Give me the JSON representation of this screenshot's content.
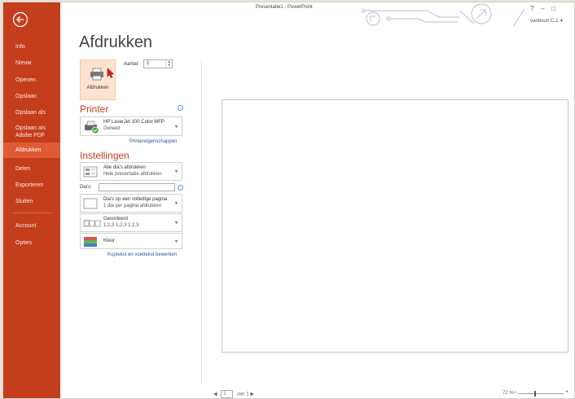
{
  "window": {
    "title": "Presentatie1 - PowerPoint",
    "help": "?",
    "minimize": "–",
    "maximize": "□",
    "user": "vanbuuri C.J. ▾"
  },
  "sidebar": {
    "items": [
      {
        "label": "Info"
      },
      {
        "label": "Nieuw"
      },
      {
        "label": "Openen"
      },
      {
        "label": "Opslaan"
      },
      {
        "label": "Opslaan als"
      },
      {
        "label": "Opslaan als Adobe PDF"
      },
      {
        "label": "Afdrukken",
        "active": true
      },
      {
        "label": "Delen"
      },
      {
        "label": "Exporteren"
      },
      {
        "label": "Sluiten"
      },
      {
        "label": "Account"
      },
      {
        "label": "Opties"
      }
    ]
  },
  "main": {
    "title": "Afdrukken",
    "print_button": "Afdrukken",
    "copies_label": "Aantal:",
    "copies_value": "1",
    "printer": {
      "section": "Printer",
      "name": "HP LaserJet 100 Color MFP",
      "status": "Gereed",
      "properties_link": "Printereigenschappen"
    },
    "settings": {
      "section": "Instellingen",
      "range_line1": "Alle dia's afdrukken",
      "range_line2": "Hele presentatie afdrukken",
      "slides_label": "Dia's:",
      "layout_line1": "Dia's op een volledige pagina",
      "layout_line2": "1 dia per pagina afdrukken",
      "collate_line1": "Gesorteerd",
      "collate_line2": "1,2,3   1,2,3   1,2,3",
      "color_line1": "Kleur",
      "header_footer_link": "Koptekst en voettekst bewerken"
    }
  },
  "preview": {
    "page": "1",
    "of": "van 1",
    "prev": "◀",
    "next": "▶",
    "zoom": "72 %",
    "zoom_minus": "–",
    "zoom_plus": "+"
  }
}
